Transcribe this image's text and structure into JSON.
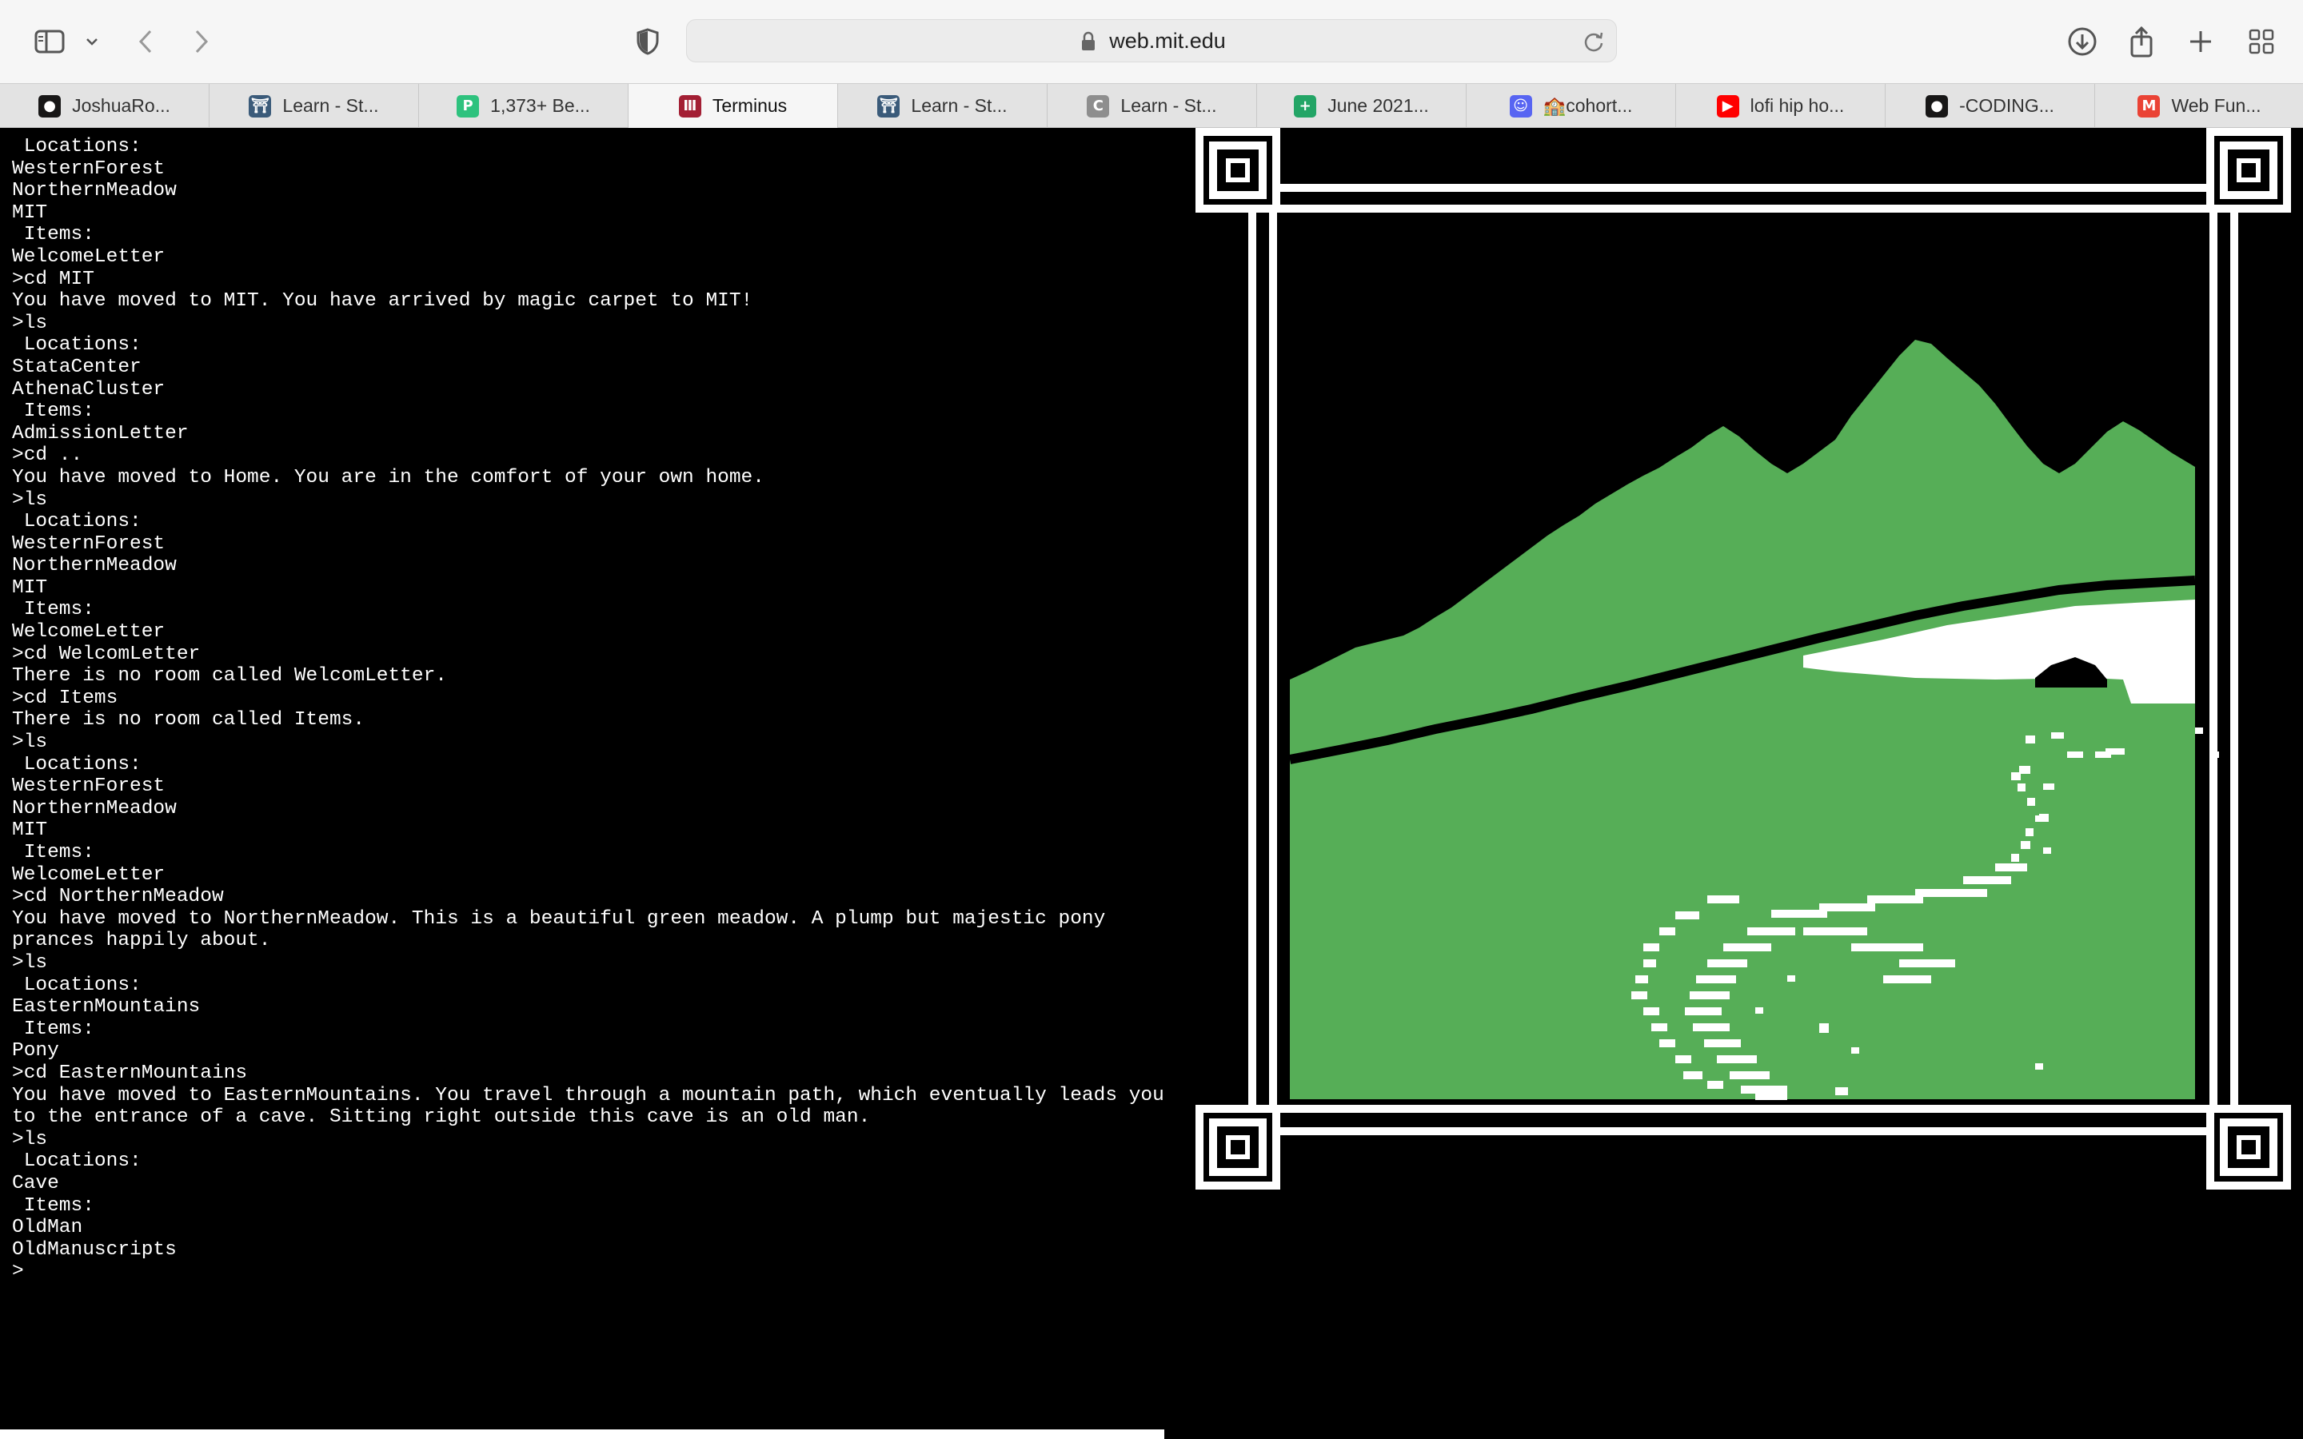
{
  "browser": {
    "url": "web.mit.edu",
    "tabs": [
      {
        "label": "JoshuaRo...",
        "icon": "github-icon",
        "color": "#181717"
      },
      {
        "label": "Learn - St...",
        "icon": "gate-icon",
        "color": "#3b5b7a"
      },
      {
        "label": "1,373+ Be...",
        "icon": "p-logo-icon",
        "color": "#2ec27e"
      },
      {
        "label": "Terminus",
        "icon": "terminus-icon",
        "color": "#a31f34",
        "active": true
      },
      {
        "label": "Learn - St...",
        "icon": "gate-icon",
        "color": "#3b5b7a"
      },
      {
        "label": "Learn - St...",
        "icon": "c-logo-icon",
        "color": "#8e8e8e"
      },
      {
        "label": "June 2021...",
        "icon": "sheets-icon",
        "color": "#23a566"
      },
      {
        "label": "🏫cohort...",
        "icon": "discord-icon",
        "color": "#5865f2"
      },
      {
        "label": "lofi hip ho...",
        "icon": "youtube-icon",
        "color": "#ff0000"
      },
      {
        "label": "-CODING...",
        "icon": "github-icon",
        "color": "#181717"
      },
      {
        "label": "Web Fun...",
        "icon": "gmail-icon",
        "color": "#ea4335"
      }
    ]
  },
  "terminal": {
    "lines": [
      " Locations:",
      "WesternForest",
      "NorthernMeadow",
      "MIT",
      " Items:",
      "WelcomeLetter",
      ">cd MIT",
      "You have moved to MIT. You have arrived by magic carpet to MIT!",
      ">ls",
      " Locations:",
      "StataCenter",
      "AthenaCluster",
      " Items:",
      "AdmissionLetter",
      ">cd ..",
      "You have moved to Home. You are in the comfort of your own home.",
      ">ls",
      " Locations:",
      "WesternForest",
      "NorthernMeadow",
      "MIT",
      " Items:",
      "WelcomeLetter",
      ">cd WelcomLetter",
      "There is no room called WelcomLetter.",
      ">cd Items",
      "There is no room called Items.",
      ">ls",
      " Locations:",
      "WesternForest",
      "NorthernMeadow",
      "MIT",
      " Items:",
      "WelcomeLetter",
      ">cd NorthernMeadow",
      "You have moved to NorthernMeadow. This is a beautiful green meadow. A plump but majestic pony",
      "prances happily about.",
      ">ls",
      " Locations:",
      "EasternMountains",
      " Items:",
      "Pony",
      ">cd EasternMountains",
      "You have moved to EasternMountains. You travel through a mountain path, which eventually leads you",
      "to the entrance of a cave. Sitting right outside this cave is an old man.",
      ">ls",
      " Locations:",
      "Cave",
      " Items:",
      "OldMan",
      "OldManuscripts",
      ">"
    ]
  },
  "scene": {
    "sky_color": "#000000",
    "land_color": "#56ae57",
    "path_color": "#ffffff",
    "frame_color": "#ffffff"
  }
}
